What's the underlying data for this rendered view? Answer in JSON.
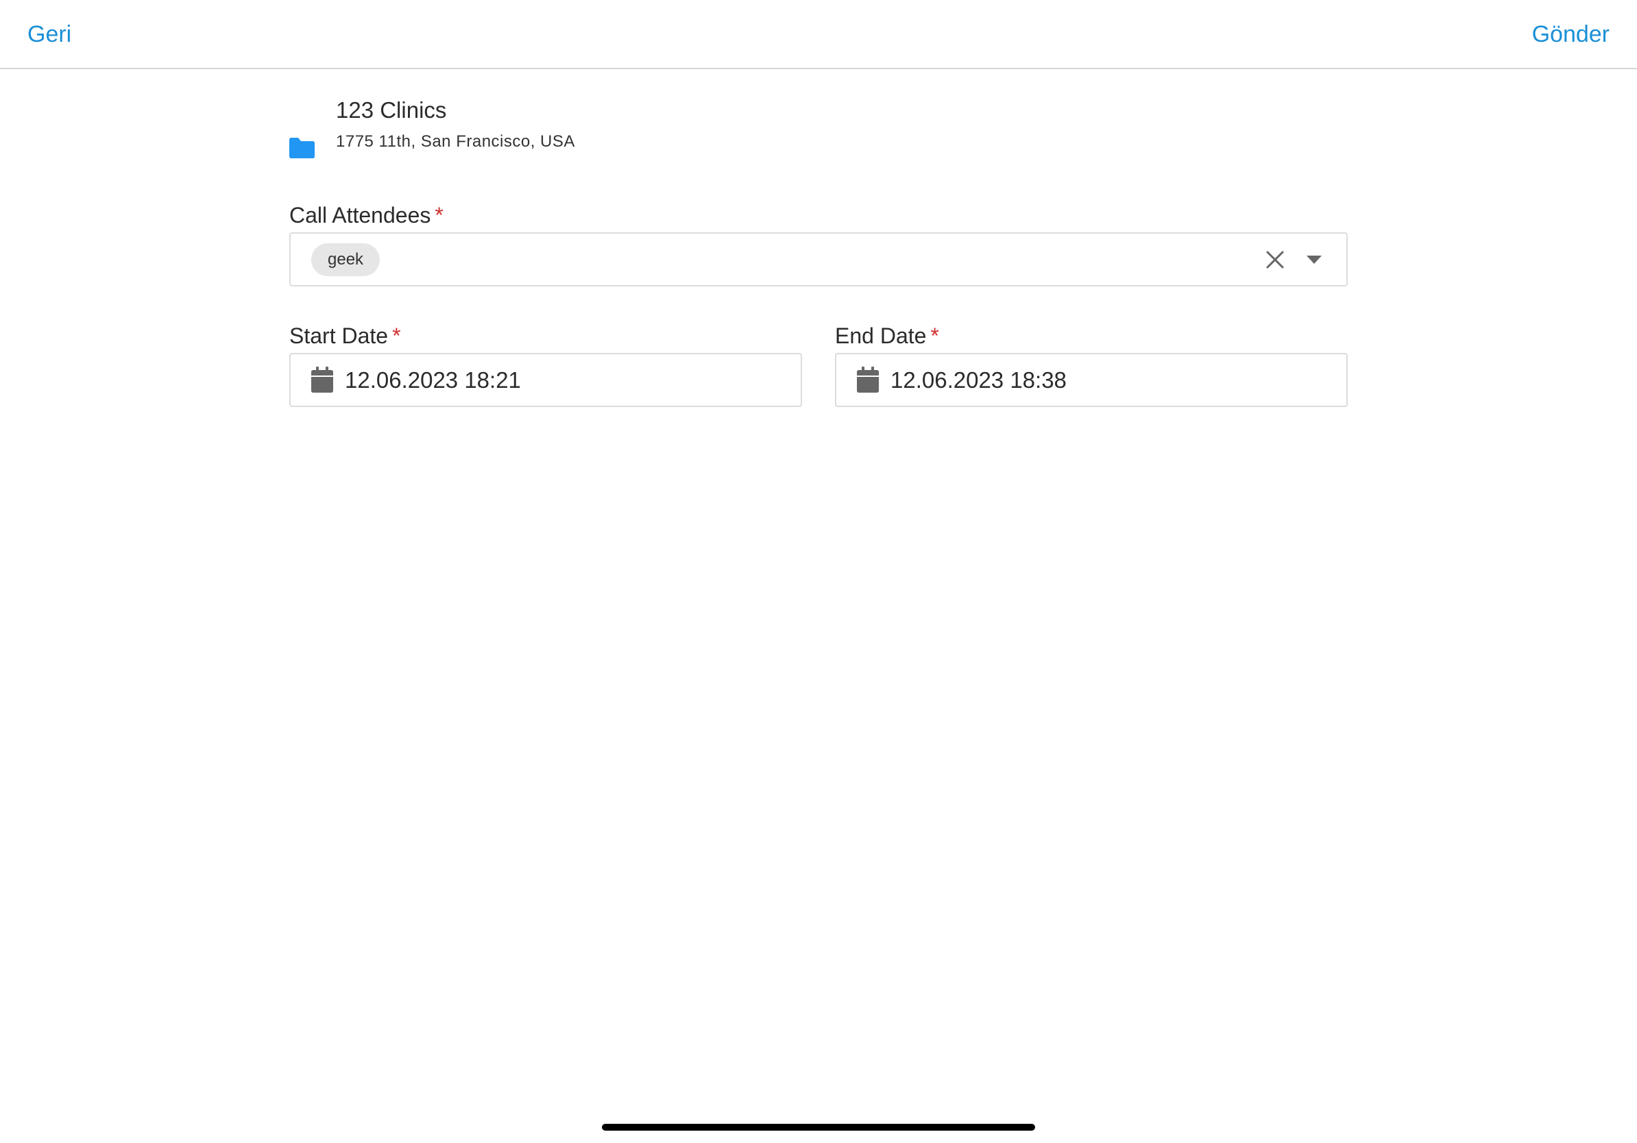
{
  "navbar": {
    "back_label": "Geri",
    "send_label": "Gönder",
    "accent_color": "#1a8fd6"
  },
  "account": {
    "icon": "folder-icon",
    "name": "123 Clinics",
    "address": "1775 11th, San Francisco, USA"
  },
  "form": {
    "required_marker": "*",
    "attendees": {
      "label": "Call Attendees",
      "selected": [
        "geek"
      ]
    },
    "start_date": {
      "label": "Start Date",
      "value": "12.06.2023 18:21",
      "icon": "calendar-icon"
    },
    "end_date": {
      "label": "End Date",
      "value": "12.06.2023 18:38",
      "icon": "calendar-icon"
    }
  }
}
